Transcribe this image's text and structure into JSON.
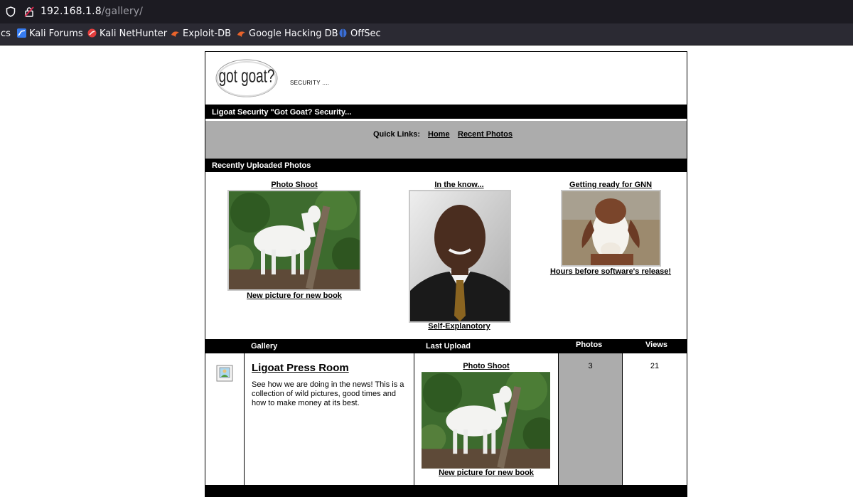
{
  "browser": {
    "url_host": "192.168.1.8",
    "url_path": "/gallery/",
    "bookmarks": [
      {
        "label": "cs"
      },
      {
        "label": "Kali Forums"
      },
      {
        "label": "Kali NetHunter"
      },
      {
        "label": "Exploit-DB"
      },
      {
        "label": "Google Hacking DB"
      },
      {
        "label": "OffSec"
      }
    ]
  },
  "header": {
    "logo_text": "got goat?",
    "tagline": "SECURITY ...."
  },
  "title_bar": "Ligoat Security \"Got Goat? Security...",
  "quick_links": {
    "label": "Quick Links:",
    "home": "Home",
    "recent": "Recent Photos"
  },
  "recent": {
    "heading": "Recently Uploaded Photos",
    "photos": [
      {
        "title": "Photo Shoot",
        "caption": "New picture for new book"
      },
      {
        "title": "In the know...",
        "caption": "Self-Explanotory"
      },
      {
        "title": "Getting ready for GNN",
        "caption": "Hours before software's release!"
      }
    ]
  },
  "table": {
    "headers": {
      "gallery": "Gallery",
      "last_upload": "Last Upload",
      "photos": "Photos",
      "views": "Views"
    },
    "rows": [
      {
        "name": "Ligoat Press Room",
        "description": "See how we are doing in the news! This is a collection of wild pictures, good times and how to make money at its best.",
        "last_title": "Photo Shoot",
        "last_caption": "New picture for new book",
        "photos": "3",
        "views": "21"
      }
    ]
  },
  "colors": {
    "chrome_dark": "#1c1b22",
    "bookmark_bar": "#2b2a33",
    "gray_panel": "#acacac"
  }
}
